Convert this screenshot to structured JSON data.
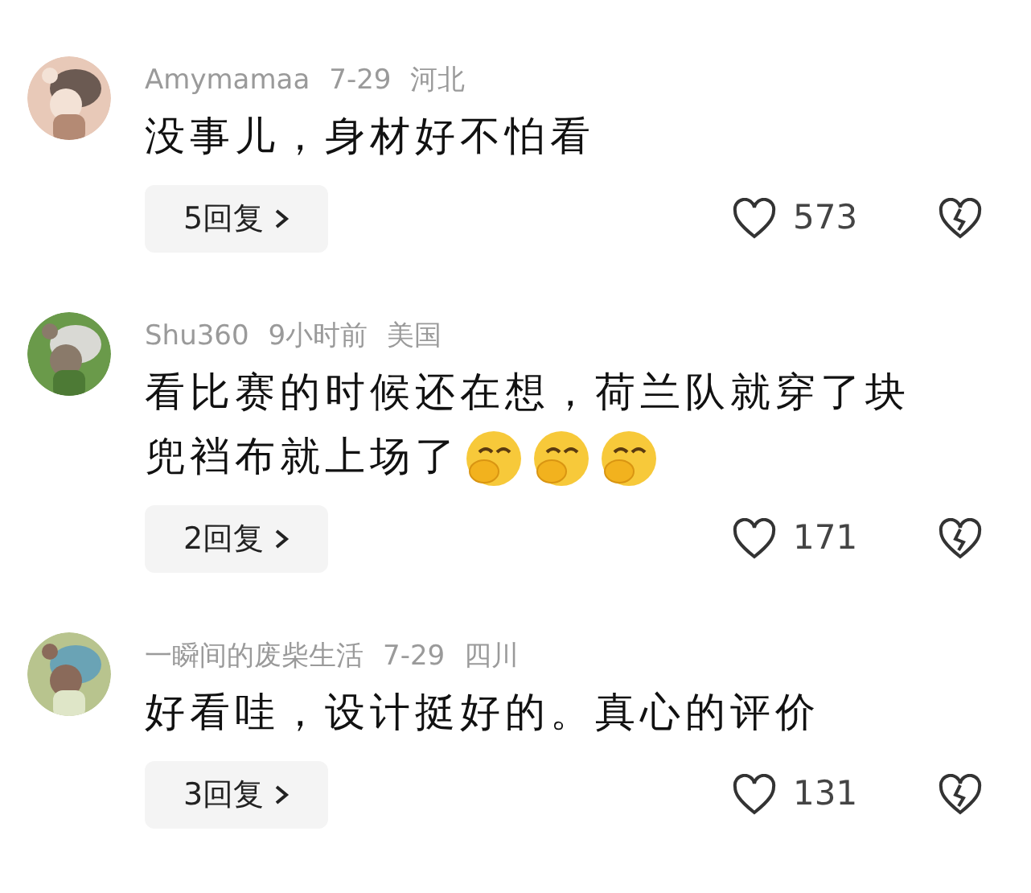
{
  "comments": [
    {
      "user": "Amymamaa",
      "time": "7-29",
      "location": "河北",
      "text": "没事儿，身材好不怕看",
      "replies": "5回复",
      "likes": "573"
    },
    {
      "user": "Shu360",
      "time": "9小时前",
      "location": "美国",
      "text": "看比赛的时候还在想，荷兰队就穿了块兜裆布就上场了",
      "emojis": [
        {
          "kind": "giggle"
        },
        {
          "kind": "giggle"
        },
        {
          "kind": "giggle"
        }
      ],
      "replies": "2回复",
      "likes": "171"
    },
    {
      "user": "一瞬间的废柴生活",
      "time": "7-29",
      "location": "四川",
      "text": "好看哇，设计挺好的。真心的评价",
      "replies": "3回复",
      "likes": "131"
    }
  ]
}
